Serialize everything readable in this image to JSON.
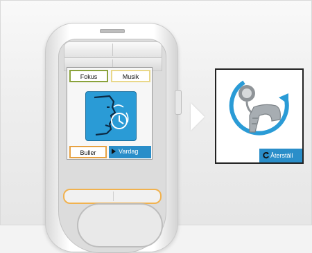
{
  "screen": {
    "tabs": {
      "fokus": "Fokus",
      "musik": "Musik",
      "buller": "Buller",
      "vardag": "Vardag"
    },
    "selected_program": "Vardag",
    "program_icon": "face-speech-clock-icon"
  },
  "panel": {
    "icon": "hearing-aid-reset-icon",
    "reset_label": "Återställ"
  },
  "colors": {
    "accent_blue": "#2a8ec9",
    "fokus_border": "#8aa23b",
    "musik_border": "#e9d88a",
    "buller_border": "#e7a141",
    "highlight_orange": "#f1b24f"
  }
}
